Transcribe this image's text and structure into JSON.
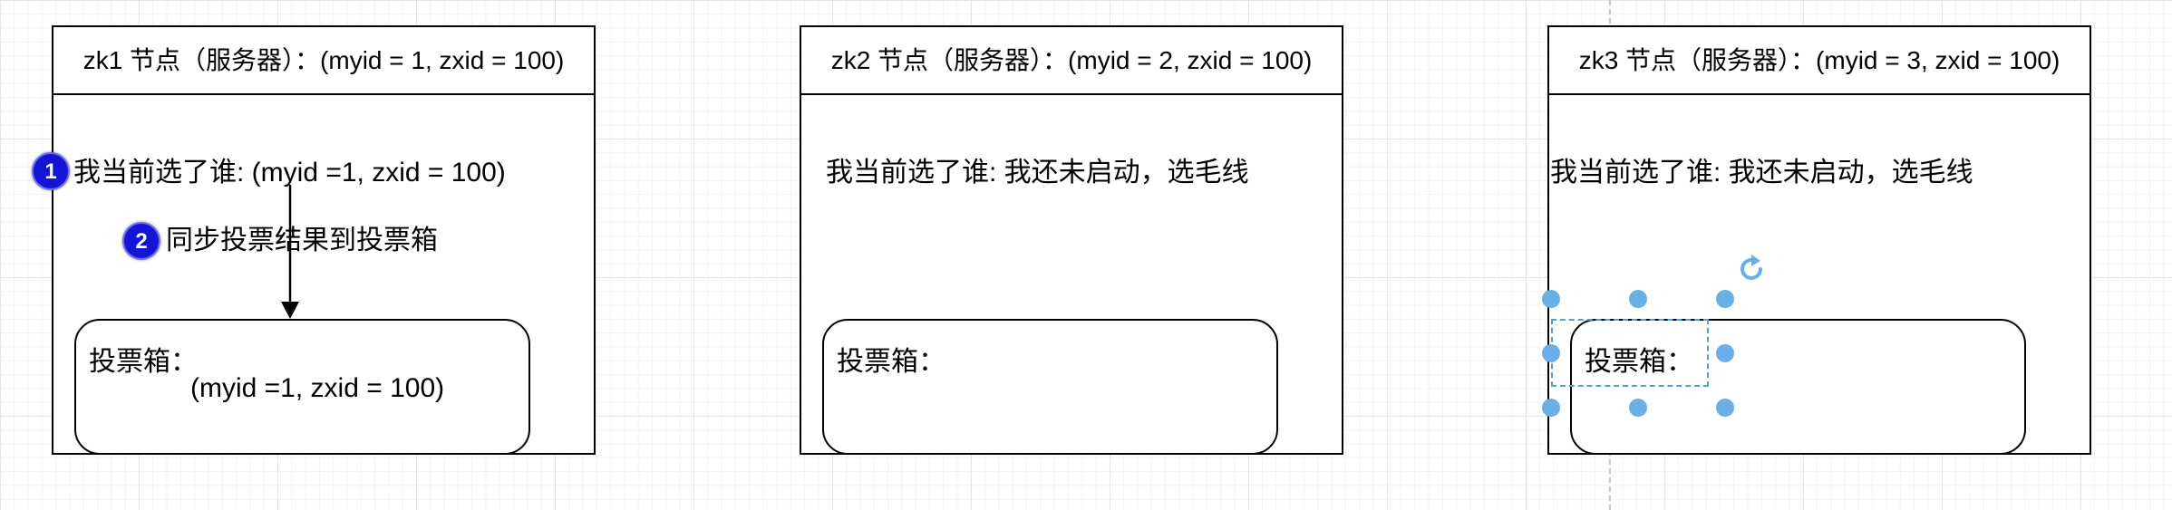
{
  "nodes": [
    {
      "title": "zk1 节点（服务器）：(myid = 1, zxid = 100)",
      "vote_text": "我当前选了谁: (myid =1, zxid = 100)",
      "ballot_box": {
        "label": "投票箱：",
        "value": "(myid =1, zxid = 100)"
      },
      "steps": [
        {
          "number": "1"
        },
        {
          "number": "2",
          "label": "同步投票结果到投票箱"
        }
      ]
    },
    {
      "title": "zk2 节点（服务器）：(myid = 2, zxid = 100)",
      "vote_text": "我当前选了谁: 我还未启动，选毛线",
      "ballot_box": {
        "label": "投票箱："
      }
    },
    {
      "title": "zk3 节点（服务器）：(myid = 3, zxid = 100)",
      "vote_text": "我当前选了谁: 我还未启动，选毛线",
      "ballot_box": {
        "label": "投票箱："
      }
    }
  ],
  "colors": {
    "badge": "#1414d6",
    "selection": "#6aaee8",
    "stroke": "#000000"
  },
  "icons": [
    "rotate-icon"
  ]
}
